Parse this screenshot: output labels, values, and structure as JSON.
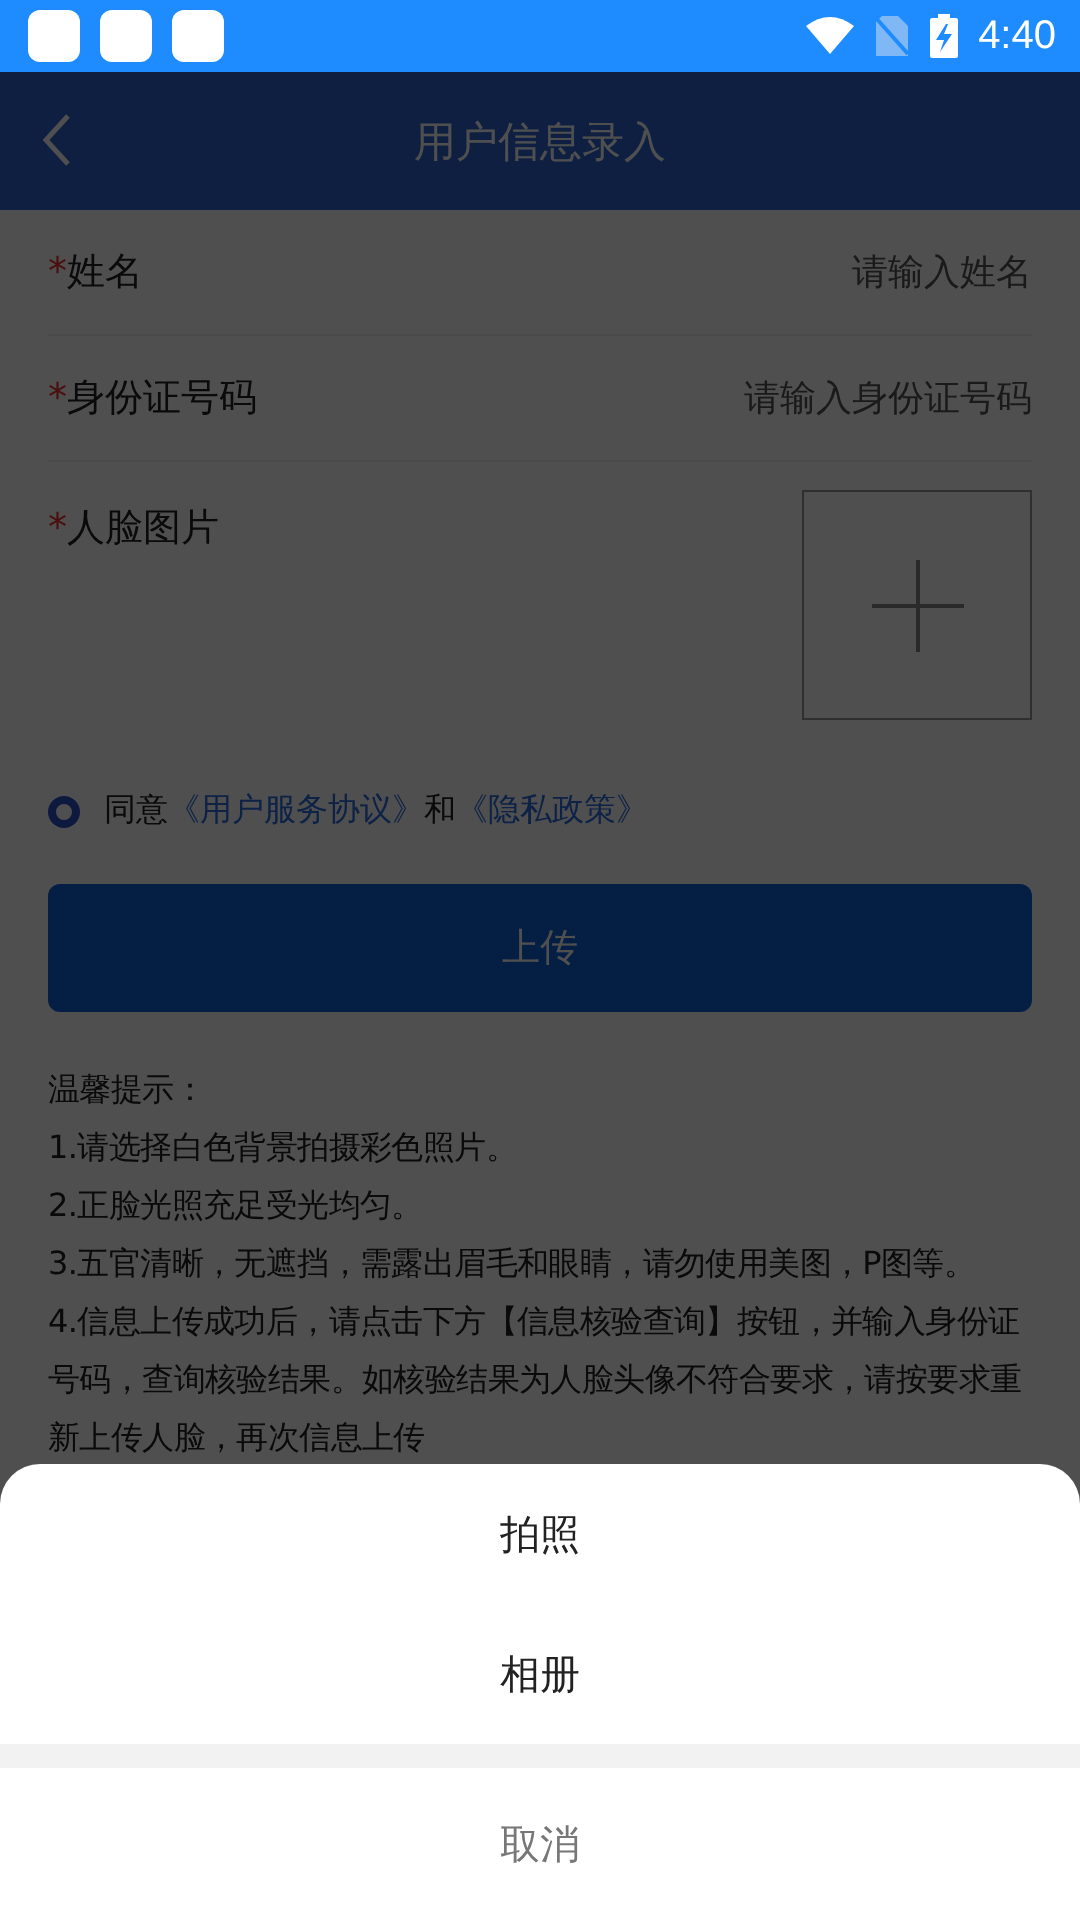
{
  "status_bar": {
    "time": "4:40"
  },
  "header": {
    "title": "用户信息录入"
  },
  "fields": [
    {
      "kind": "text",
      "label": "姓名",
      "required_mark": "*",
      "placeholder": "请输入姓名"
    },
    {
      "kind": "text",
      "label": "身份证号码",
      "required_mark": "*",
      "placeholder": "请输入身份证号码"
    },
    {
      "kind": "image",
      "label": "人脸图片",
      "required_mark": "*"
    }
  ],
  "agreement": {
    "checked": true,
    "parts": [
      {
        "kind": "text",
        "text": "同意"
      },
      {
        "kind": "link",
        "text": "《用户服务协议》"
      },
      {
        "kind": "text",
        "text": "和"
      },
      {
        "kind": "link",
        "text": "《隐私政策》"
      }
    ]
  },
  "upload_button": "上传",
  "tips": [
    "温馨提示：",
    "1.请选择白色背景拍摄彩色照片。",
    "2.正脸光照充足受光均匀。",
    "3.五官清晰，无遮挡，需露出眉毛和眼睛，请勿使用美图，P图等。",
    "4.信息上传成功后，请点击下方【信息核验查询】按钮，并输入身份证号码，查询核验结果。如核验结果为人脸头像不符合要求，请按要求重新上传人脸，再次信息上传"
  ],
  "action_sheet": {
    "options": [
      "拍照",
      "相册"
    ],
    "cancel": "取消"
  }
}
